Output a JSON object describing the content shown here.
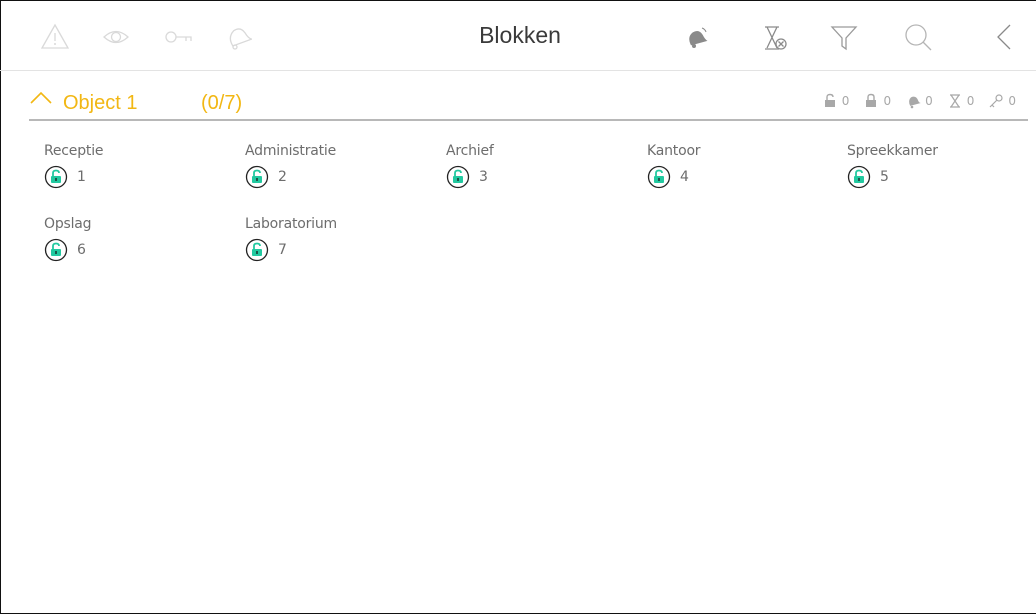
{
  "header": {
    "title": "Blokken"
  },
  "group": {
    "name": "Object 1",
    "count": "(0/7)",
    "accent_color": "#f2b713",
    "stats": [
      {
        "icon": "unlock-icon",
        "value": "0"
      },
      {
        "icon": "lock-icon",
        "value": "0"
      },
      {
        "icon": "alarm-icon",
        "value": "0"
      },
      {
        "icon": "timer-icon",
        "value": "0"
      },
      {
        "icon": "key-icon",
        "value": "0"
      }
    ]
  },
  "blocks": [
    {
      "name": "Receptie",
      "number": "1",
      "status": "unlocked"
    },
    {
      "name": "Administratie",
      "number": "2",
      "status": "unlocked"
    },
    {
      "name": "Archief",
      "number": "3",
      "status": "unlocked"
    },
    {
      "name": "Kantoor",
      "number": "4",
      "status": "unlocked"
    },
    {
      "name": "Spreekkamer",
      "number": "5",
      "status": "unlocked"
    },
    {
      "name": "Opslag",
      "number": "6",
      "status": "unlocked"
    },
    {
      "name": "Laboratorium",
      "number": "7",
      "status": "unlocked"
    }
  ],
  "colors": {
    "lock_green": "#22c9a0"
  }
}
